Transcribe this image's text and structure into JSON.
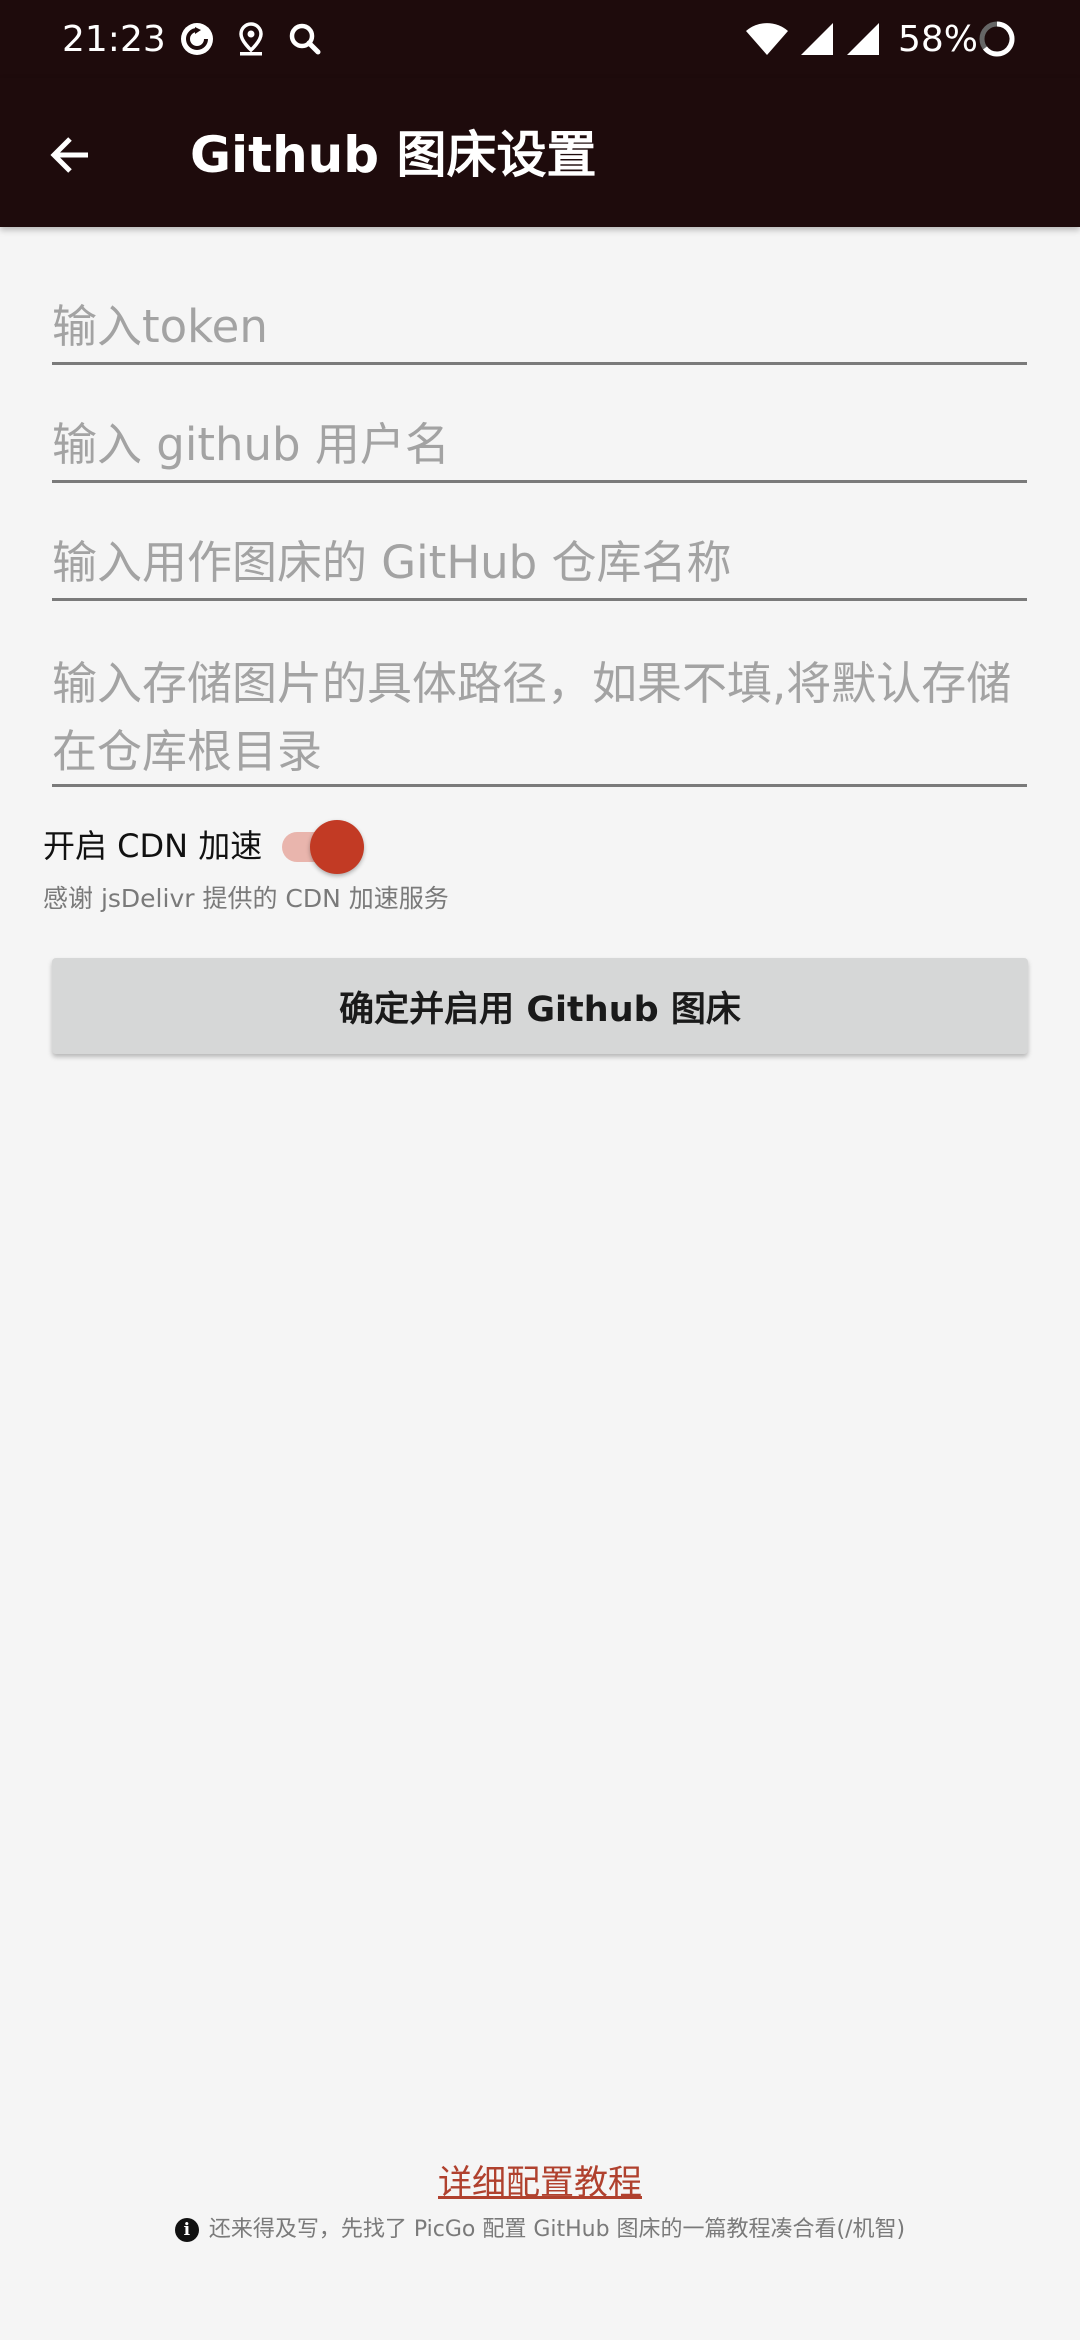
{
  "status_bar": {
    "time": "21:23",
    "battery_percent": "58%",
    "icons": [
      "sync-icon",
      "location-icon",
      "search-icon",
      "wifi-icon",
      "signal-icon",
      "signal-icon-2",
      "battery-icon"
    ]
  },
  "app_bar": {
    "title": "Github 图床设置",
    "back_icon": "arrow-back-icon"
  },
  "form": {
    "token_placeholder": "输入token",
    "username_placeholder": "输入 github 用户名",
    "repo_placeholder": "输入用作图床的 GitHub 仓库名称",
    "path_placeholder": "输入存储图片的具体路径，如果不填,将默认存储在仓库根目录",
    "token_value": "",
    "username_value": "",
    "repo_value": "",
    "path_value": ""
  },
  "cdn": {
    "label": "开启 CDN 加速",
    "enabled": true,
    "subtitle": "感谢 jsDelivr 提供的 CDN 加速服务"
  },
  "confirm_button": {
    "label": "确定并启用 Github 图床"
  },
  "footer": {
    "tutorial_link": "详细配置教程",
    "note": "还来得及写，先找了 PicGo 配置 GitHub 图床的一篇教程凑合看(/机智)",
    "info_icon": "info-icon"
  },
  "colors": {
    "app_bar": "#1e0b0c",
    "accent": "#c23a24",
    "link": "#b0412e",
    "background": "#f5f5f5"
  }
}
